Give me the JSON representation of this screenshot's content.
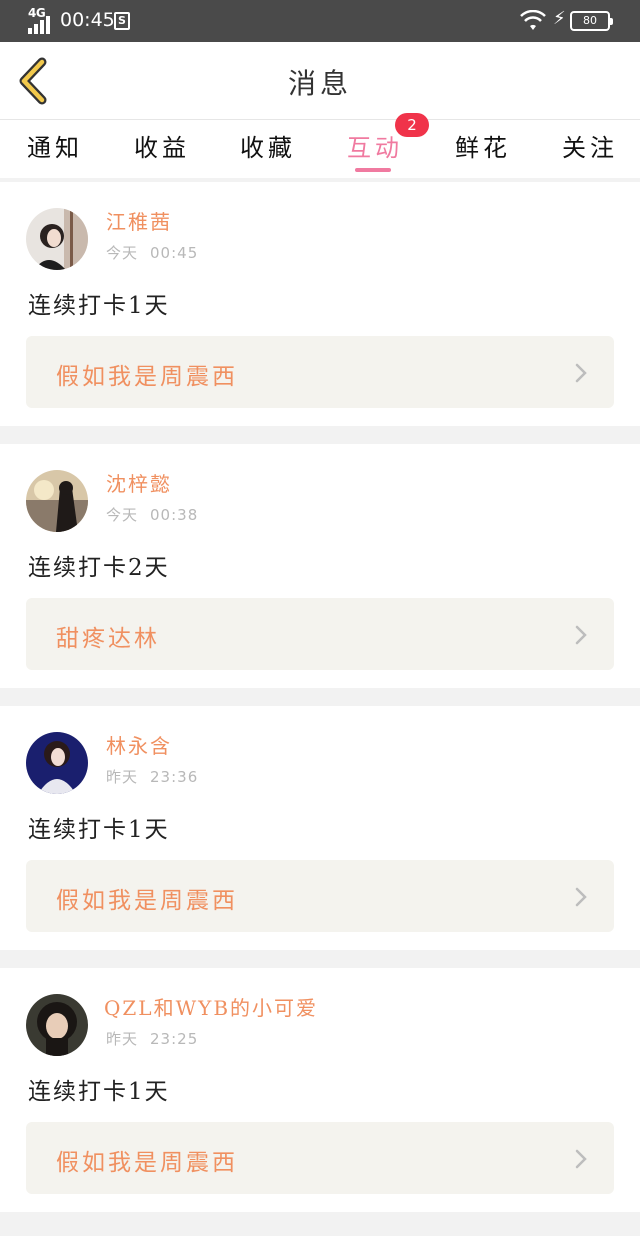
{
  "status_bar": {
    "network": "4G",
    "time": "00:45",
    "sim_icon": "S",
    "battery": "80"
  },
  "header": {
    "title": "消息",
    "back_icon": "chevron-left-icon"
  },
  "tabs": [
    {
      "label": "通知",
      "active": false
    },
    {
      "label": "收益",
      "active": false
    },
    {
      "label": "收藏",
      "active": false
    },
    {
      "label": "互动",
      "active": true,
      "badge": "2"
    },
    {
      "label": "鲜花",
      "active": false
    },
    {
      "label": "关注",
      "active": false
    }
  ],
  "colors": {
    "accent_pink": "#f07aa0",
    "badge_red": "#f0334a",
    "name_orange": "#f09060"
  },
  "messages": [
    {
      "username": "江稚茜",
      "date": "今天",
      "time": "00:45",
      "text": "连续打卡1天",
      "link": "假如我是周震西"
    },
    {
      "username": "沈梓懿",
      "date": "今天",
      "time": "00:38",
      "text": "连续打卡2天",
      "link": "甜疼达林"
    },
    {
      "username": "林永含",
      "date": "昨天",
      "time": "23:36",
      "text": "连续打卡1天",
      "link": "假如我是周震西"
    },
    {
      "username": "QZL和WYB的小可爱",
      "date": "昨天",
      "time": "23:25",
      "text": "连续打卡1天",
      "link": "假如我是周震西"
    }
  ]
}
